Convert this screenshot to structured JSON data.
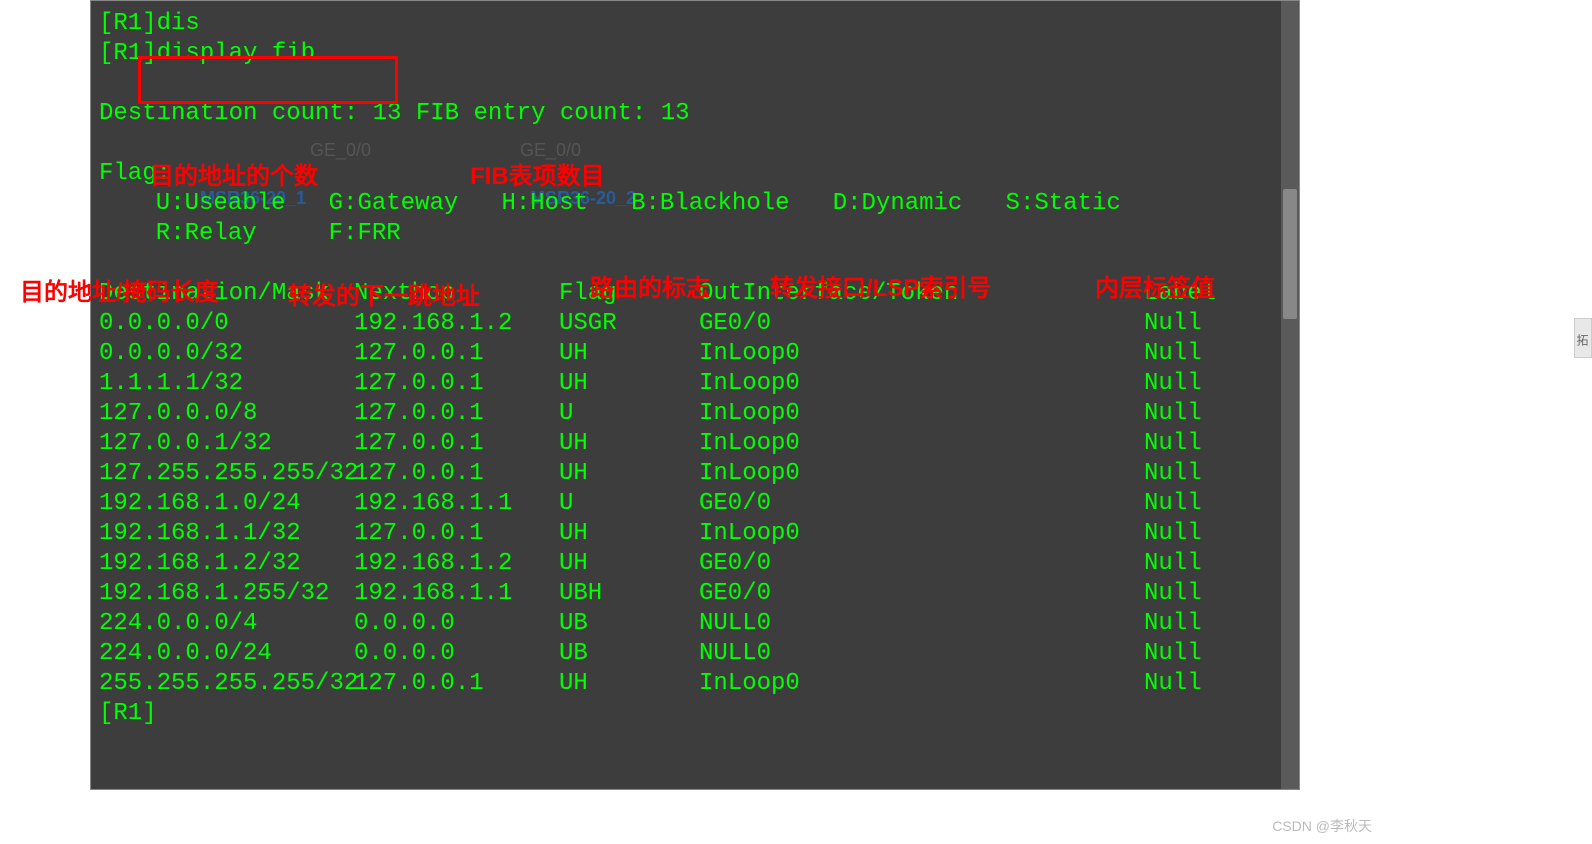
{
  "terminal": {
    "prompt_prefix": "[R1]",
    "cmd_partial": "dis",
    "cmd_full": "display fib",
    "dest_count_line": "Destination count: 13 FIB entry count: 13",
    "flag_header": "Flag:",
    "flag_line1": "  U:Useable   G:Gateway   H:Host   B:Blackhole   D:Dynamic   S:Static",
    "flag_line2": "  R:Relay     F:FRR",
    "table_headers": {
      "dest": "Destination/Mask",
      "nexthop": "Nexthop",
      "flag": "Flag",
      "iface": "OutInterface/Token",
      "label": "Label"
    },
    "rows": [
      {
        "dest": "0.0.0.0/0",
        "nexthop": "192.168.1.2",
        "flag": "USGR",
        "iface": "GE0/0",
        "label": "Null"
      },
      {
        "dest": "0.0.0.0/32",
        "nexthop": "127.0.0.1",
        "flag": "UH",
        "iface": "InLoop0",
        "label": "Null"
      },
      {
        "dest": "1.1.1.1/32",
        "nexthop": "127.0.0.1",
        "flag": "UH",
        "iface": "InLoop0",
        "label": "Null"
      },
      {
        "dest": "127.0.0.0/8",
        "nexthop": "127.0.0.1",
        "flag": "U",
        "iface": "InLoop0",
        "label": "Null"
      },
      {
        "dest": "127.0.0.1/32",
        "nexthop": "127.0.0.1",
        "flag": "UH",
        "iface": "InLoop0",
        "label": "Null"
      },
      {
        "dest": "127.255.255.255/32",
        "nexthop": "127.0.0.1",
        "flag": "UH",
        "iface": "InLoop0",
        "label": "Null"
      },
      {
        "dest": "192.168.1.0/24",
        "nexthop": "192.168.1.1",
        "flag": "U",
        "iface": "GE0/0",
        "label": "Null"
      },
      {
        "dest": "192.168.1.1/32",
        "nexthop": "127.0.0.1",
        "flag": "UH",
        "iface": "InLoop0",
        "label": "Null"
      },
      {
        "dest": "192.168.1.2/32",
        "nexthop": "192.168.1.2",
        "flag": "UH",
        "iface": "GE0/0",
        "label": "Null"
      },
      {
        "dest": "192.168.1.255/32",
        "nexthop": "192.168.1.1",
        "flag": "UBH",
        "iface": "GE0/0",
        "label": "Null"
      },
      {
        "dest": "224.0.0.0/4",
        "nexthop": "0.0.0.0",
        "flag": "UB",
        "iface": "NULL0",
        "label": "Null"
      },
      {
        "dest": "224.0.0.0/24",
        "nexthop": "0.0.0.0",
        "flag": "UB",
        "iface": "NULL0",
        "label": "Null"
      },
      {
        "dest": "255.255.255.255/32",
        "nexthop": "127.0.0.1",
        "flag": "UH",
        "iface": "InLoop0",
        "label": "Null"
      }
    ],
    "end_prompt": "[R1]"
  },
  "annotations": {
    "dest_count": "目的地址的个数",
    "fib_count": "FIB表项数目",
    "col_dest": "目的地址/掩码长度",
    "col_nexthop": "转发的下一跳地址",
    "col_flag": "路由的标志",
    "col_iface": "转发接口/LSP索引号",
    "col_label": "内层标签值"
  },
  "background": {
    "device1": "MSR36-20_1",
    "device2": "MSR36-20_2",
    "iface1": "GE_0/0",
    "iface2": "GE_0/0"
  },
  "sidebar": {
    "tab_label": "拓"
  },
  "watermark": "CSDN @李秋天"
}
